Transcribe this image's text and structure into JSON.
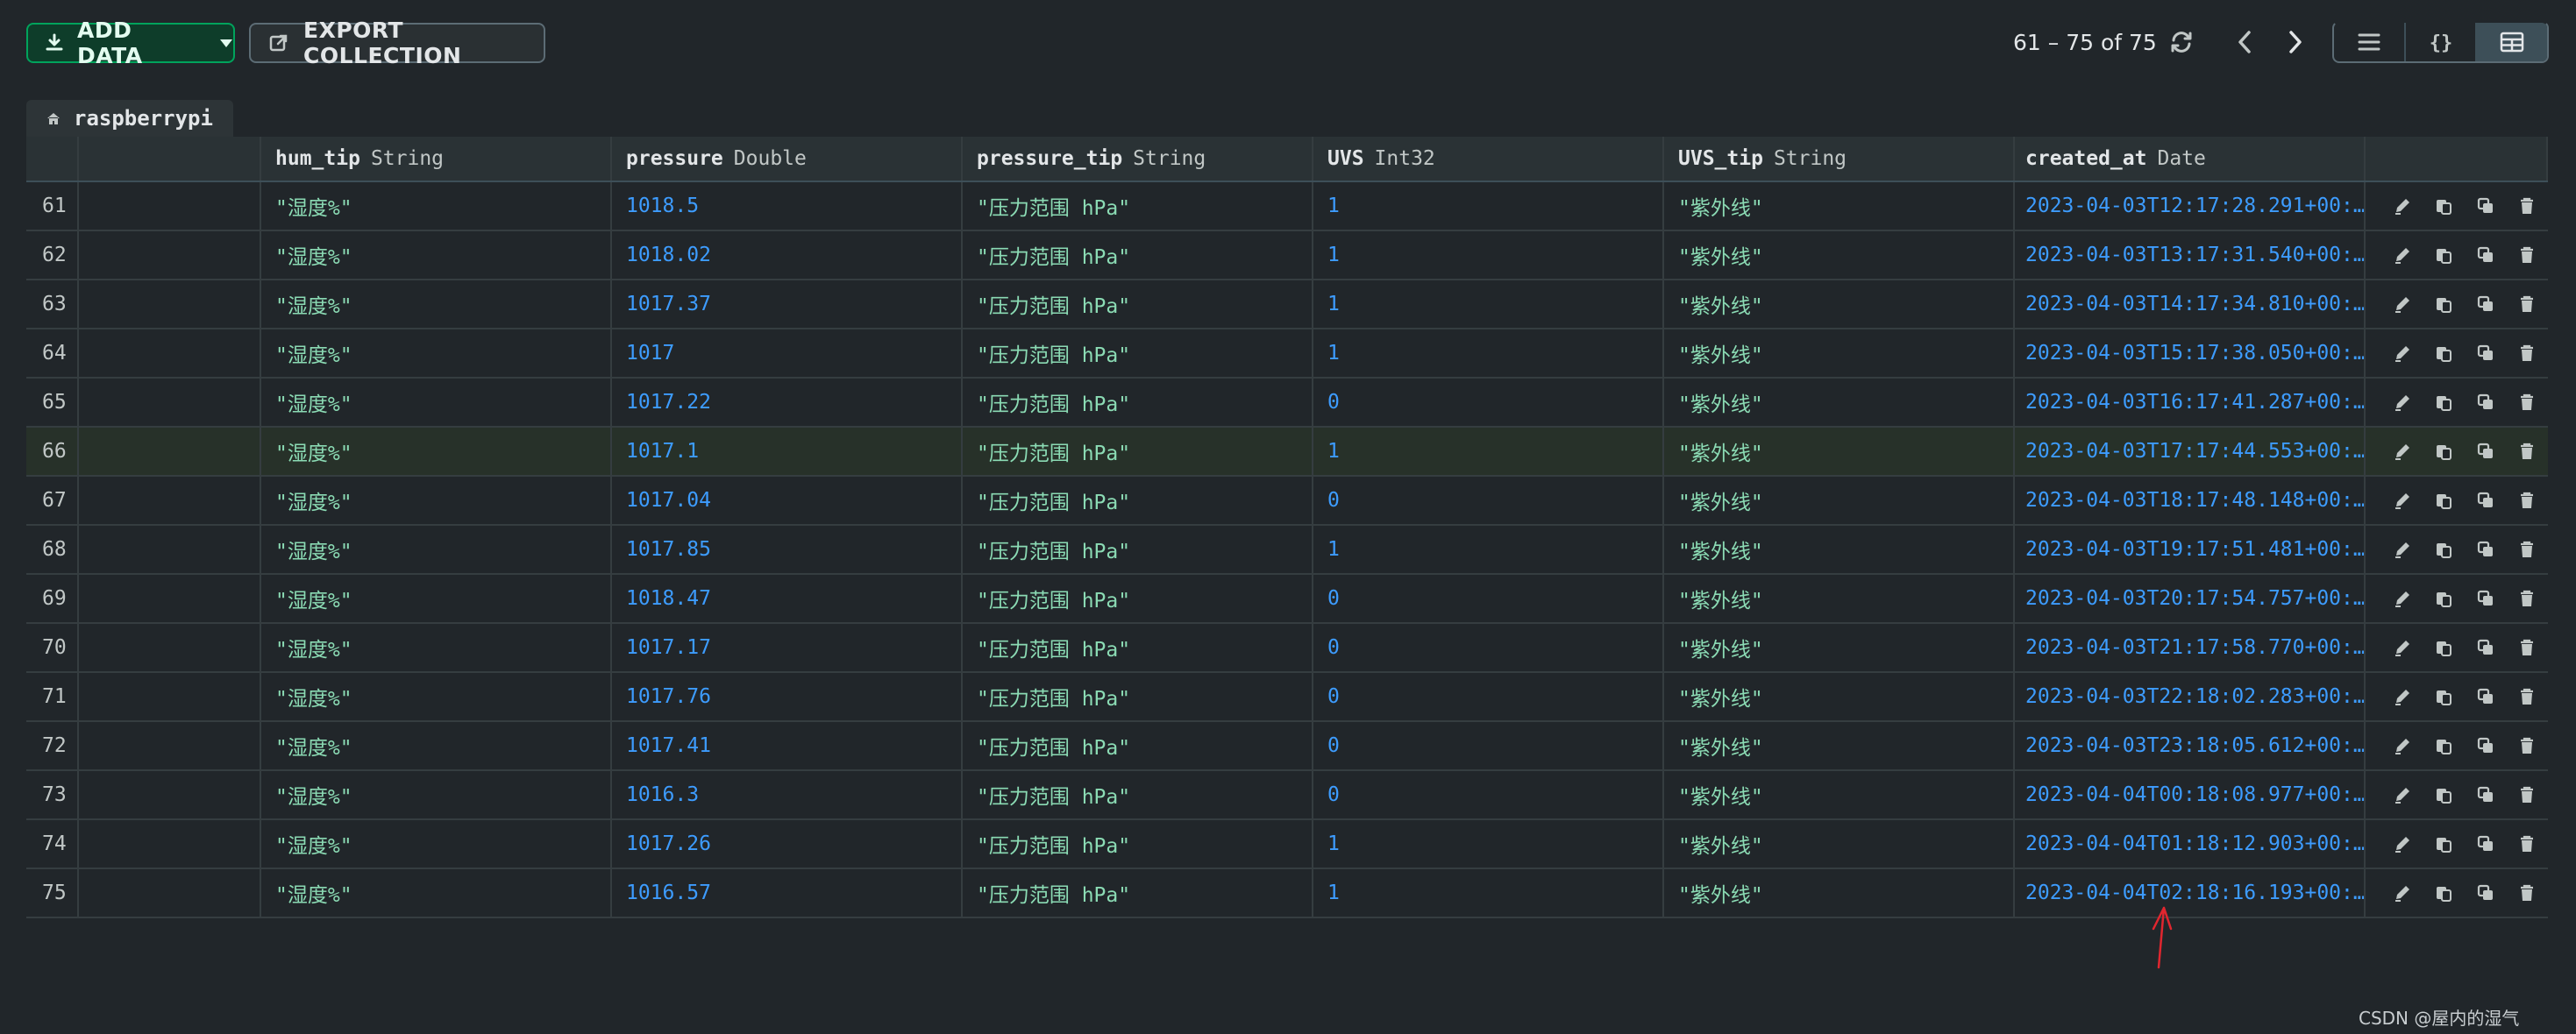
{
  "toolbar": {
    "add_data_label": "ADD DATA",
    "export_label": "EXPORT COLLECTION",
    "pager_text": "61 – 75 of 75"
  },
  "collection": {
    "name": "raspberrypi"
  },
  "columns": [
    {
      "name": "hum_tip",
      "type": "String"
    },
    {
      "name": "pressure",
      "type": "Double"
    },
    {
      "name": "pressure_tip",
      "type": "String"
    },
    {
      "name": "UVS",
      "type": "Int32"
    },
    {
      "name": "UVS_tip",
      "type": "String"
    },
    {
      "name": "created_at",
      "type": "Date"
    }
  ],
  "rows": [
    {
      "idx": "61",
      "hum_tip": "\"湿度%\"",
      "pressure": "1018.5",
      "pressure_tip": "\"压力范围 hPa\"",
      "uvs": "1",
      "uvs_tip": "\"紫外线\"",
      "created_at": "2023-04-03T12:17:28.291+00:…"
    },
    {
      "idx": "62",
      "hum_tip": "\"湿度%\"",
      "pressure": "1018.02",
      "pressure_tip": "\"压力范围 hPa\"",
      "uvs": "1",
      "uvs_tip": "\"紫外线\"",
      "created_at": "2023-04-03T13:17:31.540+00:…"
    },
    {
      "idx": "63",
      "hum_tip": "\"湿度%\"",
      "pressure": "1017.37",
      "pressure_tip": "\"压力范围 hPa\"",
      "uvs": "1",
      "uvs_tip": "\"紫外线\"",
      "created_at": "2023-04-03T14:17:34.810+00:…"
    },
    {
      "idx": "64",
      "hum_tip": "\"湿度%\"",
      "pressure": "1017",
      "pressure_tip": "\"压力范围 hPa\"",
      "uvs": "1",
      "uvs_tip": "\"紫外线\"",
      "created_at": "2023-04-03T15:17:38.050+00:…"
    },
    {
      "idx": "65",
      "hum_tip": "\"湿度%\"",
      "pressure": "1017.22",
      "pressure_tip": "\"压力范围 hPa\"",
      "uvs": "0",
      "uvs_tip": "\"紫外线\"",
      "created_at": "2023-04-03T16:17:41.287+00:…"
    },
    {
      "idx": "66",
      "hum_tip": "\"湿度%\"",
      "pressure": "1017.1",
      "pressure_tip": "\"压力范围 hPa\"",
      "uvs": "1",
      "uvs_tip": "\"紫外线\"",
      "created_at": "2023-04-03T17:17:44.553+00:…"
    },
    {
      "idx": "67",
      "hum_tip": "\"湿度%\"",
      "pressure": "1017.04",
      "pressure_tip": "\"压力范围 hPa\"",
      "uvs": "0",
      "uvs_tip": "\"紫外线\"",
      "created_at": "2023-04-03T18:17:48.148+00:…"
    },
    {
      "idx": "68",
      "hum_tip": "\"湿度%\"",
      "pressure": "1017.85",
      "pressure_tip": "\"压力范围 hPa\"",
      "uvs": "1",
      "uvs_tip": "\"紫外线\"",
      "created_at": "2023-04-03T19:17:51.481+00:…"
    },
    {
      "idx": "69",
      "hum_tip": "\"湿度%\"",
      "pressure": "1018.47",
      "pressure_tip": "\"压力范围 hPa\"",
      "uvs": "0",
      "uvs_tip": "\"紫外线\"",
      "created_at": "2023-04-03T20:17:54.757+00:…"
    },
    {
      "idx": "70",
      "hum_tip": "\"湿度%\"",
      "pressure": "1017.17",
      "pressure_tip": "\"压力范围 hPa\"",
      "uvs": "0",
      "uvs_tip": "\"紫外线\"",
      "created_at": "2023-04-03T21:17:58.770+00:…"
    },
    {
      "idx": "71",
      "hum_tip": "\"湿度%\"",
      "pressure": "1017.76",
      "pressure_tip": "\"压力范围 hPa\"",
      "uvs": "0",
      "uvs_tip": "\"紫外线\"",
      "created_at": "2023-04-03T22:18:02.283+00:…"
    },
    {
      "idx": "72",
      "hum_tip": "\"湿度%\"",
      "pressure": "1017.41",
      "pressure_tip": "\"压力范围 hPa\"",
      "uvs": "0",
      "uvs_tip": "\"紫外线\"",
      "created_at": "2023-04-03T23:18:05.612+00:…"
    },
    {
      "idx": "73",
      "hum_tip": "\"湿度%\"",
      "pressure": "1016.3",
      "pressure_tip": "\"压力范围 hPa\"",
      "uvs": "0",
      "uvs_tip": "\"紫外线\"",
      "created_at": "2023-04-04T00:18:08.977+00:…"
    },
    {
      "idx": "74",
      "hum_tip": "\"湿度%\"",
      "pressure": "1017.26",
      "pressure_tip": "\"压力范围 hPa\"",
      "uvs": "1",
      "uvs_tip": "\"紫外线\"",
      "created_at": "2023-04-04T01:18:12.903+00:…"
    },
    {
      "idx": "75",
      "hum_tip": "\"湿度%\"",
      "pressure": "1016.57",
      "pressure_tip": "\"压力范围 hPa\"",
      "uvs": "1",
      "uvs_tip": "\"紫外线\"",
      "created_at": "2023-04-04T02:18:16.193+00:…"
    }
  ],
  "highlighted_row": "66",
  "icons": {
    "add": "download-icon",
    "caret": "caret-down-icon",
    "export": "export-icon",
    "refresh": "refresh-icon",
    "prev": "chevron-left-icon",
    "next": "chevron-right-icon",
    "list_view": "list-view-icon",
    "json_view": "json-view-icon",
    "table_view": "table-view-icon",
    "home": "home-icon",
    "edit": "pencil-icon",
    "copy": "clipboard-copy-icon",
    "clone": "clone-icon",
    "delete": "trash-icon"
  },
  "colors": {
    "background": "#21262a",
    "accent_green": "#00a35c",
    "string_value": "#8bdbb4",
    "number_value": "#3d9cff",
    "annotation_red": "#e0262f"
  },
  "watermark": "CSDN @屋内的湿气"
}
